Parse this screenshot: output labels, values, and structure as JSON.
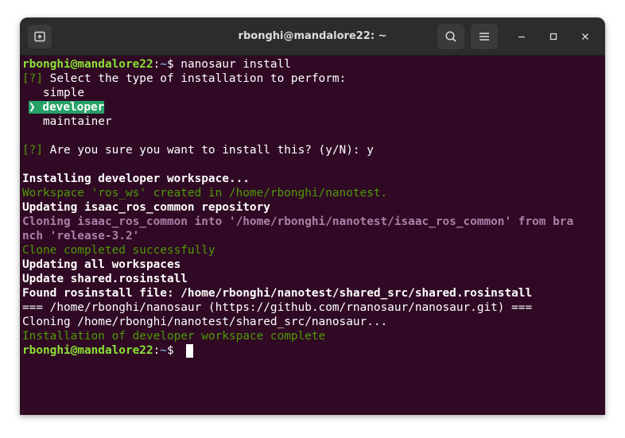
{
  "window": {
    "title": "rbonghi@mandalore22: ~"
  },
  "icons": {
    "new_tab": "new-tab-icon",
    "search": "search-icon",
    "menu": "hamburger-menu-icon",
    "minimize": "minimize-icon",
    "maximize": "maximize-icon",
    "close": "close-icon"
  },
  "colors": {
    "terminal_bg": "#300a24",
    "titlebar_bg": "#2c2c2c",
    "prompt_user": "#8ae234",
    "prompt_path": "#729fcf",
    "success_green": "#4e9a06",
    "cloning_magenta": "#ad7fa8",
    "selection_bg": "#26a269"
  },
  "terminal": {
    "prompt_user": "rbonghi@mandalore22",
    "prompt_sep": ":",
    "prompt_path": "~",
    "prompt_dollar": "$ ",
    "command": "nanosaur install",
    "q1_mark": "[?]",
    "q1_text": " Select the type of installation to perform:",
    "opt_simple": "simple",
    "opt_selected_arrow": "❯",
    "opt_developer": "developer",
    "opt_maintainer": "maintainer",
    "q2_mark": "[?]",
    "q2_text": " Are you sure you want to install this? (y/N): y",
    "log": {
      "installing": "Installing developer workspace...",
      "workspace_created": "Workspace 'ros_ws' created in /home/rbonghi/nanotest.",
      "updating_repo": "Updating isaac_ros_common repository",
      "cloning_1": "Cloning isaac_ros_common into '/home/rbonghi/nanotest/isaac_ros_common' from bra",
      "cloning_2": "nch 'release-3.2'",
      "clone_done": "Clone completed successfully",
      "updating_all": "Updating all workspaces",
      "update_shared": "Update shared.rosinstall",
      "found_file": "Found rosinstall file: /home/rbonghi/nanotest/shared_src/shared.rosinstall",
      "repo_header": "=== /home/rbonghi/nanosaur (https://github.com/rnanosaur/nanosaur.git) ===",
      "cloning_nanosaur": "Cloning /home/rbonghi/nanotest/shared_src/nanosaur...",
      "complete": "Installation of developer workspace complete"
    }
  }
}
